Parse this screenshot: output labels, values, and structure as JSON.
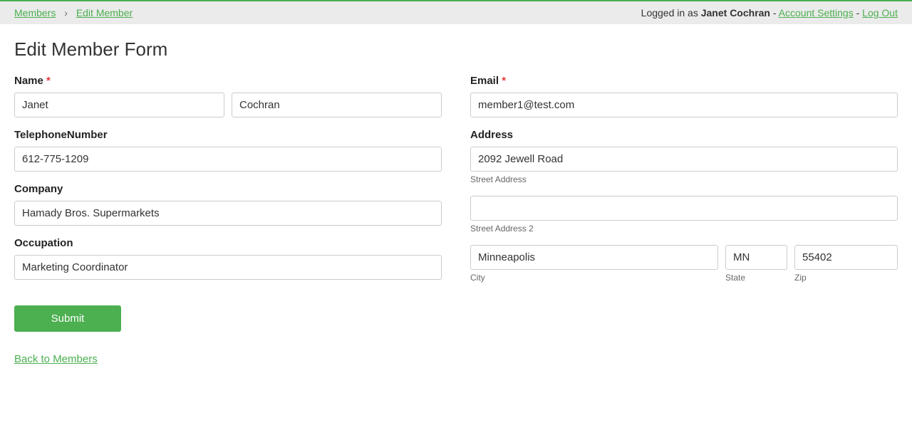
{
  "breadcrumb": {
    "members": "Members",
    "edit_member": "Edit Member"
  },
  "user_info": {
    "logged_in_as": "Logged in as ",
    "user_name": "Janet Cochran",
    "account_settings": "Account Settings",
    "log_out": "Log Out"
  },
  "page_title": "Edit Member Form",
  "labels": {
    "name": "Name",
    "email": "Email",
    "telephone": "TelephoneNumber",
    "address": "Address",
    "company": "Company",
    "occupation": "Occupation",
    "street_address": "Street Address",
    "street_address_2": "Street Address 2",
    "city": "City",
    "state": "State",
    "zip": "Zip"
  },
  "values": {
    "first_name": "Janet",
    "last_name": "Cochran",
    "email": "member1@test.com",
    "telephone": "612-775-1209",
    "street1": "2092 Jewell Road",
    "street2": "",
    "company": "Hamady Bros. Supermarkets",
    "occupation": "Marketing Coordinator",
    "city": "Minneapolis",
    "state": "MN",
    "zip": "55402"
  },
  "buttons": {
    "submit": "Submit",
    "back": "Back to Members"
  }
}
